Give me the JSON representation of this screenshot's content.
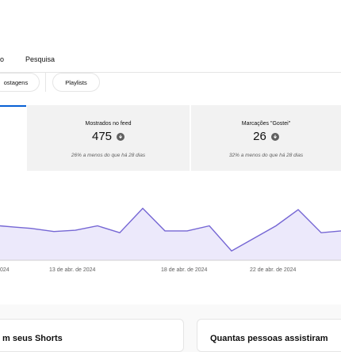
{
  "tabs": [
    "o",
    "Pesquisa"
  ],
  "chips": [
    "ostagens",
    "Playlists"
  ],
  "metrics": [
    {
      "label": "Mostrados no feed",
      "value": "475",
      "sub": "26% a menos do que há 28 dias"
    },
    {
      "label": "Marcações \"Gostei\"",
      "value": "26",
      "sub": "32% a menos do que há 28 dias"
    }
  ],
  "chart_data": {
    "type": "area",
    "x_ticks": [
      "024",
      "13 de abr. de 2024",
      "18 de abr. de 2024",
      "22 de abr. de 2024"
    ],
    "y_range": [
      0,
      100
    ],
    "values": [
      55,
      53,
      51,
      46,
      48,
      55,
      44,
      83,
      47,
      47,
      55,
      15,
      35,
      55,
      81,
      44,
      47
    ],
    "colors": {
      "line": "#7566d4",
      "fill": "#ece9fb"
    }
  },
  "cards": [
    {
      "title": "m seus Shorts"
    },
    {
      "title": "Quantas pessoas assistiram"
    }
  ]
}
